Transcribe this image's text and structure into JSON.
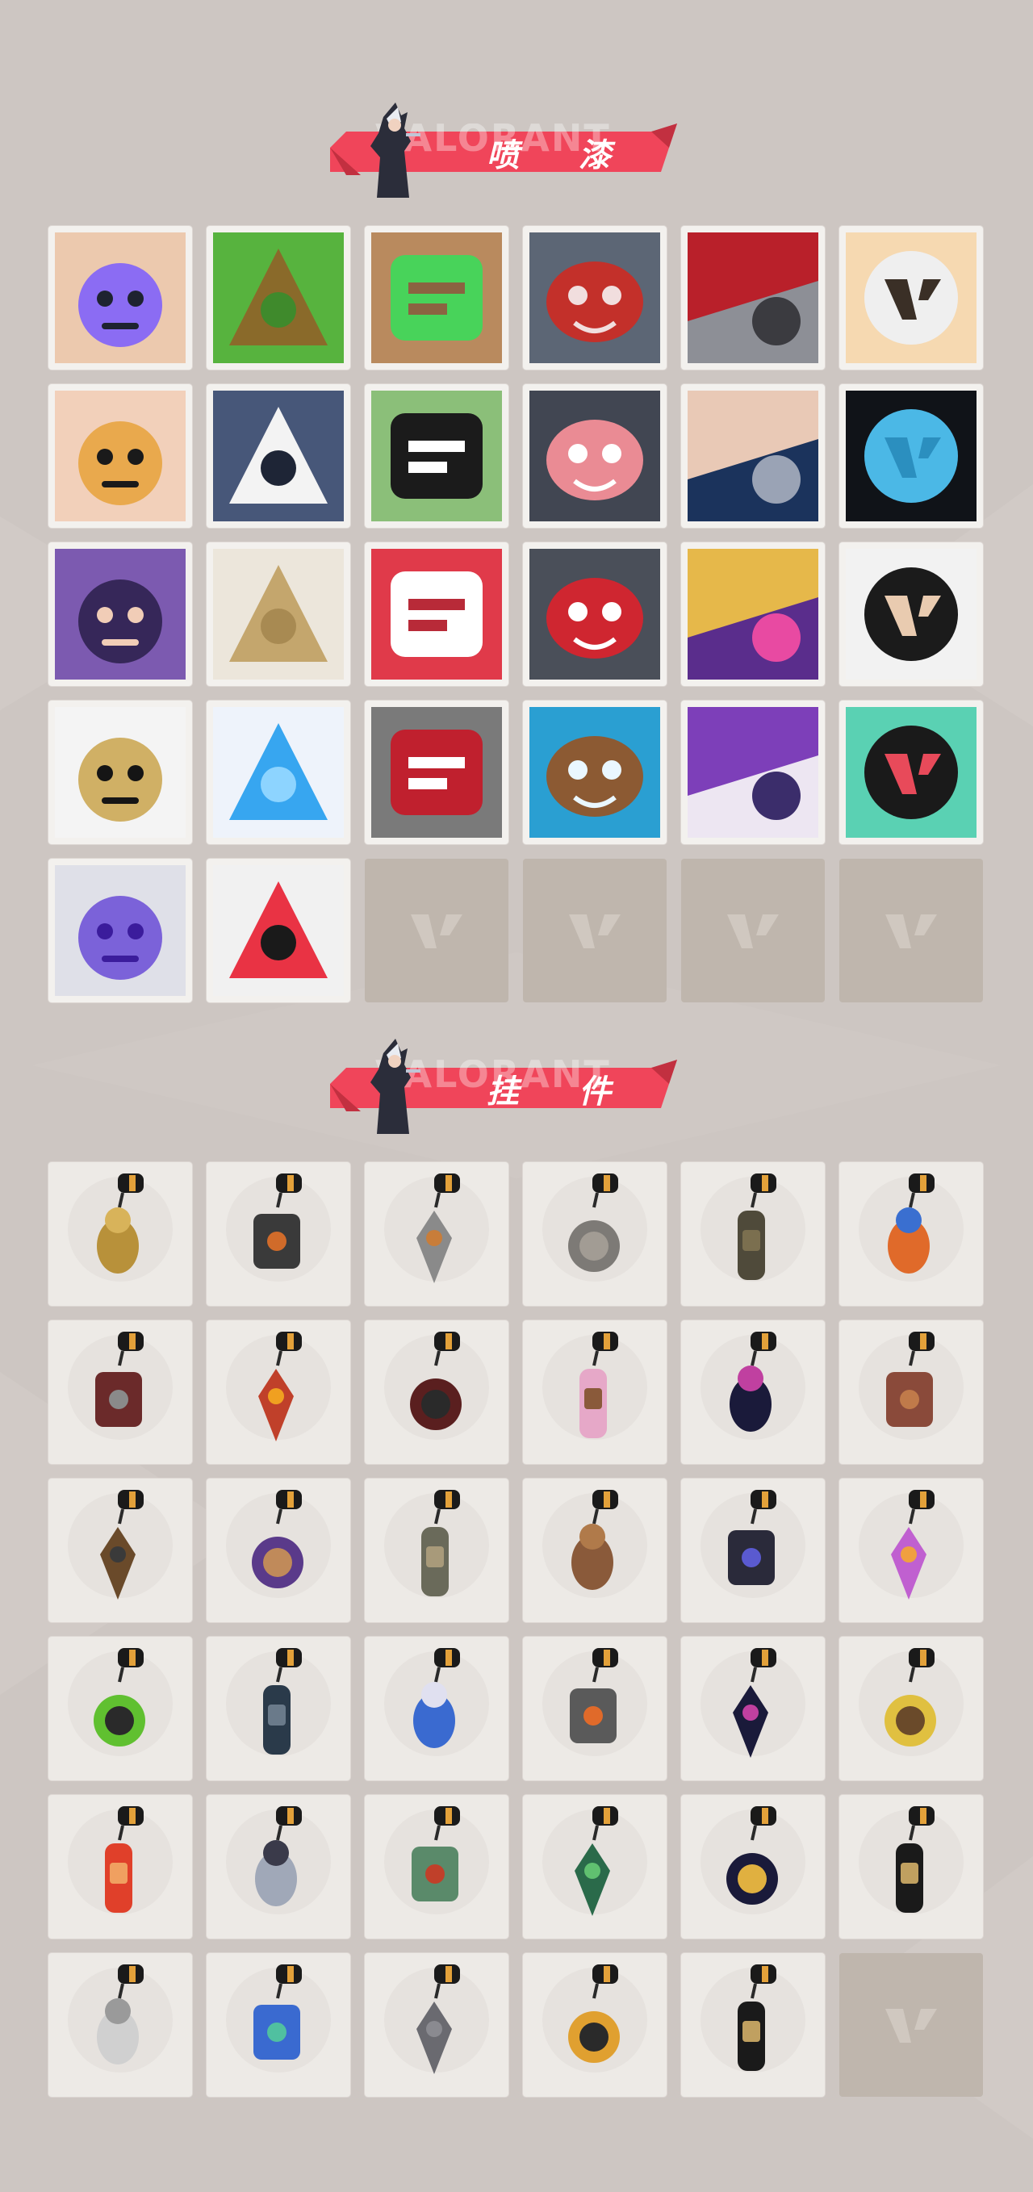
{
  "sections": {
    "sprays": {
      "title": "喷 漆",
      "watermark": "VALORANT"
    },
    "buddies": {
      "title": "挂 件",
      "watermark": "VALORANT"
    }
  },
  "colors": {
    "background": "#cdc6c2",
    "ribbon": "#f0455a",
    "tile": "#f3f1ee",
    "empty_tile": "#bfb6ad"
  },
  "sprays": [
    {
      "icon": "boy-face-spray-icon",
      "c1": "#ecc9ae",
      "c2": "#1e2330",
      "c3": "#7a5cff"
    },
    {
      "icon": "green-box-spray-icon",
      "c1": "#57b33e",
      "c2": "#8a6a2a",
      "c3": "#3f8a2c"
    },
    {
      "icon": "brown-creature-spray-icon",
      "c1": "#b98a5e",
      "c2": "#48d35a",
      "c3": "#8b6341"
    },
    {
      "icon": "crying-cat-spray-icon",
      "c1": "#5c6675",
      "c2": "#c3302a",
      "c3": "#f1dede"
    },
    {
      "icon": "red-cake-spray-icon",
      "c1": "#8d8f96",
      "c2": "#b9202a",
      "c3": "#3b3b40"
    },
    {
      "icon": "tiger-spray-icon",
      "c1": "#f6d9b1",
      "c2": "#efefef",
      "c3": "#3a2f26"
    },
    {
      "icon": "girl-face-spray-icon",
      "c1": "#f2d0ba",
      "c2": "#1a1a1a",
      "c3": "#e7a23a"
    },
    {
      "icon": "penguin-spray-icon",
      "c1": "#475779",
      "c2": "#f3f3f3",
      "c3": "#1e2536"
    },
    {
      "icon": "frog-spray-icon",
      "c1": "#8bbf79",
      "c2": "#1b1b1b",
      "c3": "#ffffff"
    },
    {
      "icon": "grey-cat-spray-icon",
      "c1": "#414652",
      "c2": "#ea8b94",
      "c3": "#ffffff"
    },
    {
      "icon": "hooded-agent-spray-icon",
      "c1": "#1b335c",
      "c2": "#e9c9b6",
      "c3": "#9aa3b5"
    },
    {
      "icon": "blue-rune-spray-icon",
      "c1": "#101318",
      "c2": "#4bb8e6",
      "c3": "#2b8fbf"
    },
    {
      "icon": "purple-agent-spray-icon",
      "c1": "#7c5ab0",
      "c2": "#f1cdb7",
      "c3": "#2a1f4a"
    },
    {
      "icon": "gold-x-spray-icon",
      "c1": "#ece6db",
      "c2": "#c4a66d",
      "c3": "#a88a52"
    },
    {
      "icon": "number-spray-icon",
      "c1": "#e03a4a",
      "c2": "#ffffff",
      "c3": "#b82a38"
    },
    {
      "icon": "bandana-cat-spray-icon",
      "c1": "#4a4f59",
      "c2": "#cf2630",
      "c3": "#ffffff"
    },
    {
      "icon": "champions-spray-icon",
      "c1": "#5a2d8c",
      "c2": "#e6b84a",
      "c3": "#e84aa2"
    },
    {
      "icon": "glasses-duo-spray-icon",
      "c1": "#f2f2f2",
      "c2": "#1b1b1b",
      "c3": "#e9cbb0"
    },
    {
      "icon": "silhouette-spray-icon",
      "c1": "#f4f4f4",
      "c2": "#151515",
      "c3": "#c9a34b"
    },
    {
      "icon": "neon-stars-spray-icon",
      "c1": "#eef3fb",
      "c2": "#37a6f0",
      "c3": "#8dd4ff"
    },
    {
      "icon": "red-x-button-spray-icon",
      "c1": "#7a7a7a",
      "c2": "#c0202e",
      "c3": "#ffffff"
    },
    {
      "icon": "wave-bear-spray-icon",
      "c1": "#2a9fd2",
      "c2": "#8c5a33",
      "c3": "#eaf7ff"
    },
    {
      "icon": "purple-sword-agent-spray-icon",
      "c1": "#ede6f2",
      "c2": "#7d3fb9",
      "c3": "#3b2d6b"
    },
    {
      "icon": "valorant-logo-splat-spray-icon",
      "c1": "#5ad1b3",
      "c2": "#1a1a1a",
      "c3": "#e84a5a"
    },
    {
      "icon": "graffiti-spray-icon",
      "c1": "#dfe0e8",
      "c2": "#3b1c9c",
      "c3": "#6a4bd6"
    },
    {
      "icon": "red-valorant-logo-spray-icon",
      "c1": "#f1f1f1",
      "c2": "#e93344",
      "c3": "#1a1a1a"
    }
  ],
  "spray_empty_slots": 4,
  "buddies": [
    {
      "icon": "golden-cat-buddy-icon",
      "c1": "#b8913a",
      "c2": "#d8b35a"
    },
    {
      "icon": "drone-buddy-icon",
      "c1": "#3a3a3a",
      "c2": "#d06b2a"
    },
    {
      "icon": "fruit-cart-buddy-icon",
      "c1": "#8a8a8a",
      "c2": "#c87d3a"
    },
    {
      "icon": "raccoon-buddy-icon",
      "c1": "#7d7a76",
      "c2": "#a29c94"
    },
    {
      "icon": "round-bag-buddy-icon",
      "c1": "#4f4a3a",
      "c2": "#7b6f4f"
    },
    {
      "icon": "blue-bottle-buddy-icon",
      "c1": "#e06a2a",
      "c2": "#3a6fd0"
    },
    {
      "icon": "spiked-blade-buddy-icon",
      "c1": "#6b2a2a",
      "c2": "#8a8a8a"
    },
    {
      "icon": "red-pepper-buddy-icon",
      "c1": "#c0402a",
      "c2": "#f0a020"
    },
    {
      "icon": "braided-rope-buddy-icon",
      "c1": "#5a1f1f",
      "c2": "#2a2a2a"
    },
    {
      "icon": "cupcake-buddy-icon",
      "c1": "#e6a8c8",
      "c2": "#8a5a3a"
    },
    {
      "icon": "ep9-medal-buddy-icon",
      "c1": "#1a1a3a",
      "c2": "#c040a0"
    },
    {
      "icon": "teddy-bell-buddy-icon",
      "c1": "#8a4a3a",
      "c2": "#c07a4a"
    },
    {
      "icon": "wooden-gun-buddy-icon",
      "c1": "#6a4a2a",
      "c2": "#3a3a3a"
    },
    {
      "icon": "agent-figure-buddy-icon",
      "c1": "#5a3a8a",
      "c2": "#c08a5a"
    },
    {
      "icon": "cowboy-figure-buddy-icon",
      "c1": "#6a6a5a",
      "c2": "#a89a7a"
    },
    {
      "icon": "treasure-box-buddy-icon",
      "c1": "#8a5a3a",
      "c2": "#b07a4a"
    },
    {
      "icon": "tassel-charm-buddy-icon",
      "c1": "#2a2a3a",
      "c2": "#5a5ad0"
    },
    {
      "icon": "lava-lamp-buddy-icon",
      "c1": "#c060d0",
      "c2": "#f0a040"
    },
    {
      "icon": "green-pager-buddy-icon",
      "c1": "#60c030",
      "c2": "#2a2a2a"
    },
    {
      "icon": "sneaker-buddy-icon",
      "c1": "#2a3a4a",
      "c2": "#6a7a8a"
    },
    {
      "icon": "astronaut-buddy-icon",
      "c1": "#3a6ad0",
      "c2": "#e0e0f0"
    },
    {
      "icon": "radio-buddy-icon",
      "c1": "#5a5a5a",
      "c2": "#e06a2a"
    },
    {
      "icon": "ep9-coin-buddy-icon",
      "c1": "#1a1a3a",
      "c2": "#c040a0"
    },
    {
      "icon": "banana-slice-buddy-icon",
      "c1": "#e0c040",
      "c2": "#6a4a2a"
    },
    {
      "icon": "tanghulu-skewer-buddy-icon",
      "c1": "#e0402a",
      "c2": "#f0a060"
    },
    {
      "icon": "ghost-card-buddy-icon",
      "c1": "#a0a8b8",
      "c2": "#3a3a4a"
    },
    {
      "icon": "robot-buddy-icon",
      "c1": "#5a8a6a",
      "c2": "#c0402a"
    },
    {
      "icon": "soda-can-buddy-icon",
      "c1": "#2a6a4a",
      "c2": "#60c070"
    },
    {
      "icon": "ep9-ring-buddy-icon",
      "c1": "#1a1a3a",
      "c2": "#e0b040"
    },
    {
      "icon": "black-card-buddy-icon",
      "c1": "#1a1a1a",
      "c2": "#c0a060"
    },
    {
      "icon": "edg-badge-buddy-icon",
      "c1": "#d0d0d0",
      "c2": "#9a9a9a"
    },
    {
      "icon": "ufo-buddy-icon",
      "c1": "#3a6ad0",
      "c2": "#50c0a0"
    },
    {
      "icon": "grey-hedgehog-buddy-icon",
      "c1": "#6a6a70",
      "c2": "#8a8a90"
    },
    {
      "icon": "bee-buddy-icon",
      "c1": "#e0a030",
      "c2": "#2a2a2a"
    },
    {
      "icon": "valorant-coin-buddy-icon",
      "c1": "#1a1a1a",
      "c2": "#c0a060"
    }
  ],
  "buddy_empty_slots": 1
}
